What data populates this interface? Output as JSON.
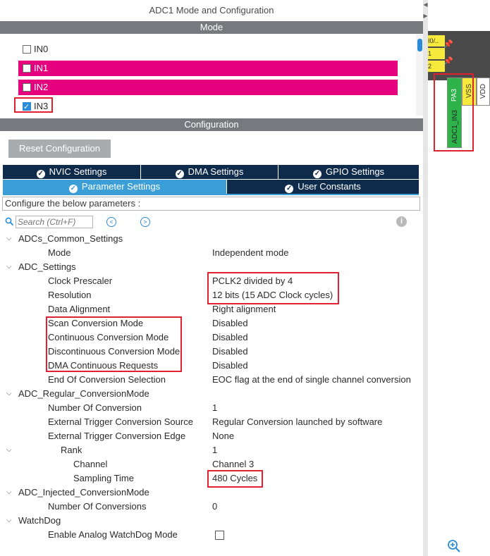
{
  "window": {
    "title": "ADC1 Mode and Configuration"
  },
  "mode_section": {
    "header": "Mode",
    "items": [
      {
        "label": "IN0",
        "checked": false,
        "highlighted": false
      },
      {
        "label": "IN1",
        "checked": false,
        "highlighted": true
      },
      {
        "label": "IN2",
        "checked": false,
        "highlighted": true
      },
      {
        "label": "IN3",
        "checked": true,
        "highlighted": false
      }
    ]
  },
  "config_section": {
    "header": "Configuration",
    "reset_button": "Reset Configuration",
    "tabs_row1": [
      "NVIC Settings",
      "DMA Settings",
      "GPIO Settings"
    ],
    "tabs_row2": [
      "Parameter Settings",
      "User Constants"
    ],
    "active_tab": "Parameter Settings",
    "configure_text": "Configure the below parameters :",
    "search_placeholder": "Search (Ctrl+F)"
  },
  "parameters": [
    {
      "name": "ADCs_Common_Settings",
      "value": "",
      "level": 0,
      "group": true
    },
    {
      "name": "Mode",
      "value": "Independent mode",
      "level": 1,
      "group": false
    },
    {
      "name": "ADC_Settings",
      "value": "",
      "level": 0,
      "group": true
    },
    {
      "name": "Clock Prescaler",
      "value": "PCLK2 divided by 4",
      "level": 1,
      "group": false
    },
    {
      "name": "Resolution",
      "value": "12 bits (15 ADC Clock cycles)",
      "level": 1,
      "group": false
    },
    {
      "name": "Data Alignment",
      "value": "Right alignment",
      "level": 1,
      "group": false
    },
    {
      "name": "Scan Conversion Mode",
      "value": "Disabled",
      "level": 1,
      "group": false
    },
    {
      "name": "Continuous Conversion Mode",
      "value": "Disabled",
      "level": 1,
      "group": false
    },
    {
      "name": "Discontinuous Conversion Mode",
      "value": "Disabled",
      "level": 1,
      "group": false
    },
    {
      "name": "DMA Continuous Requests",
      "value": "Disabled",
      "level": 1,
      "group": false
    },
    {
      "name": "End Of Conversion Selection",
      "value": "EOC flag at the end of single channel conversion",
      "level": 1,
      "group": false
    },
    {
      "name": "ADC_Regular_ConversionMode",
      "value": "",
      "level": 0,
      "group": true
    },
    {
      "name": "Number Of Conversion",
      "value": "1",
      "level": 1,
      "group": false
    },
    {
      "name": "External Trigger Conversion Source",
      "value": "Regular Conversion launched by software",
      "level": 1,
      "group": false
    },
    {
      "name": "External Trigger Conversion Edge",
      "value": "None",
      "level": 1,
      "group": false
    },
    {
      "name": "Rank",
      "value": "1",
      "level": 1,
      "group": true
    },
    {
      "name": "Channel",
      "value": "Channel 3",
      "level": 2,
      "group": false
    },
    {
      "name": "Sampling Time",
      "value": "480 Cycles",
      "level": 2,
      "group": false
    },
    {
      "name": "ADC_Injected_ConversionMode",
      "value": "",
      "level": 0,
      "group": true
    },
    {
      "name": "Number Of Conversions",
      "value": "0",
      "level": 1,
      "group": false
    },
    {
      "name": "WatchDog",
      "value": "",
      "level": 0,
      "group": true
    },
    {
      "name": "Enable Analog WatchDog Mode",
      "value": "",
      "level": 1,
      "group": false,
      "checkbox": true
    }
  ],
  "pinout": {
    "pins_top": [
      "I0/..",
      "1",
      "2"
    ],
    "pin_labels": [
      "PA3",
      "VSS",
      "VDD"
    ],
    "signal_label": "ADC1_IN3"
  },
  "colors": {
    "highlight": "#e5007e",
    "tab_dark": "#0f2b4c",
    "tab_active": "#3b9ed6",
    "annotation_red": "#e0212f",
    "pin_green": "#2db34a",
    "pin_yellow": "#f7ea3c"
  },
  "icons": [
    "check-circle-icon",
    "search-icon",
    "arrow-left-icon",
    "arrow-right-icon",
    "info-icon",
    "chevron-down-icon",
    "zoom-in-icon",
    "pushpin-icon"
  ]
}
